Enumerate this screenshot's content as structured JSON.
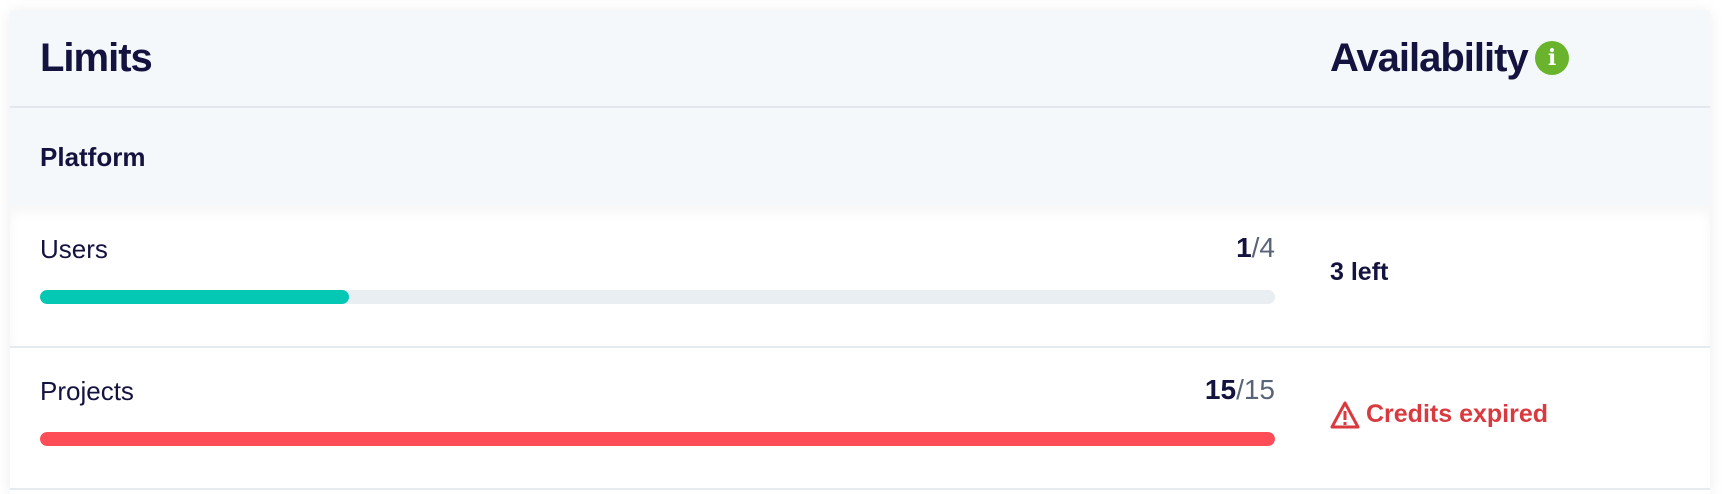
{
  "header": {
    "limits_title": "Limits",
    "availability_title": "Availability",
    "info_icon": "info-icon",
    "info_glyph": "i"
  },
  "section": {
    "title": "Platform"
  },
  "rows": [
    {
      "label": "Users",
      "used": "1",
      "separator": "/",
      "total": "4",
      "progress_fraction": 0.25,
      "bar_color": "#04c7b4",
      "availability": "3 left"
    },
    {
      "label": "Projects",
      "used": "15",
      "separator": "/",
      "total": "15",
      "progress_fraction": 1.0,
      "bar_color": "#ff4d58",
      "availability": "Credits expired",
      "availability_icon": "warning-icon",
      "availability_color": "#d93a3f"
    }
  ],
  "colors": {
    "background": "#f5f8fb",
    "text": "#14123f",
    "info_green": "#6ab42d",
    "track": "#e9eef2"
  }
}
